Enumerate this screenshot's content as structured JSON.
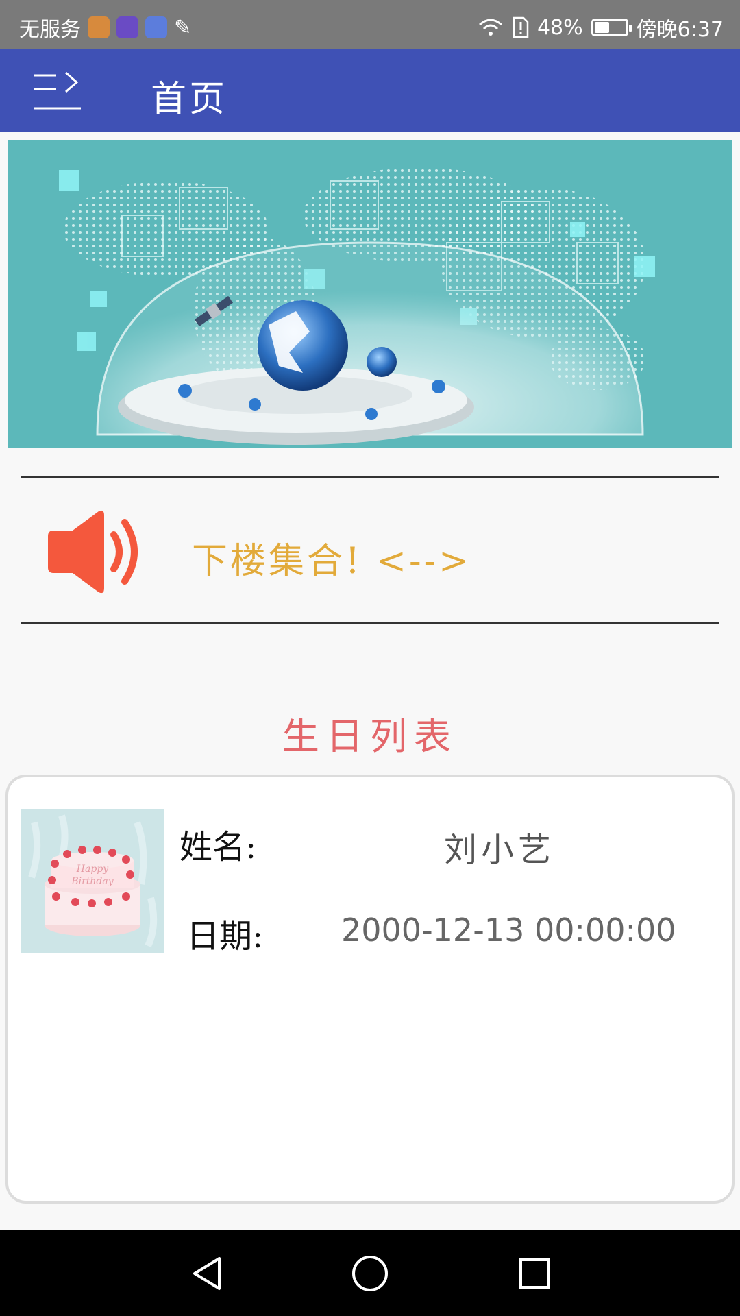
{
  "status_bar": {
    "carrier": "无服务",
    "battery": "48%",
    "battery_level": 0.48,
    "time": "傍晚6:37"
  },
  "app_bar": {
    "title": "首页"
  },
  "notice": {
    "text": "下楼集合! <-->"
  },
  "section": {
    "title": "生日列表"
  },
  "birthday_list": [
    {
      "name_label": "姓名:",
      "name": "刘小艺",
      "date_label": "日期:",
      "date": "2000-12-13 00:00:00"
    }
  ],
  "icons": {
    "menu": "menu-icon",
    "speaker": "speaker-icon",
    "back": "back-triangle-icon",
    "home": "home-circle-icon",
    "recents": "recents-square-icon"
  },
  "colors": {
    "app_bar": "#3f51b5",
    "notice_text": "#e2aa3a",
    "section_title": "#e3666a",
    "speaker": "#f4583d"
  }
}
